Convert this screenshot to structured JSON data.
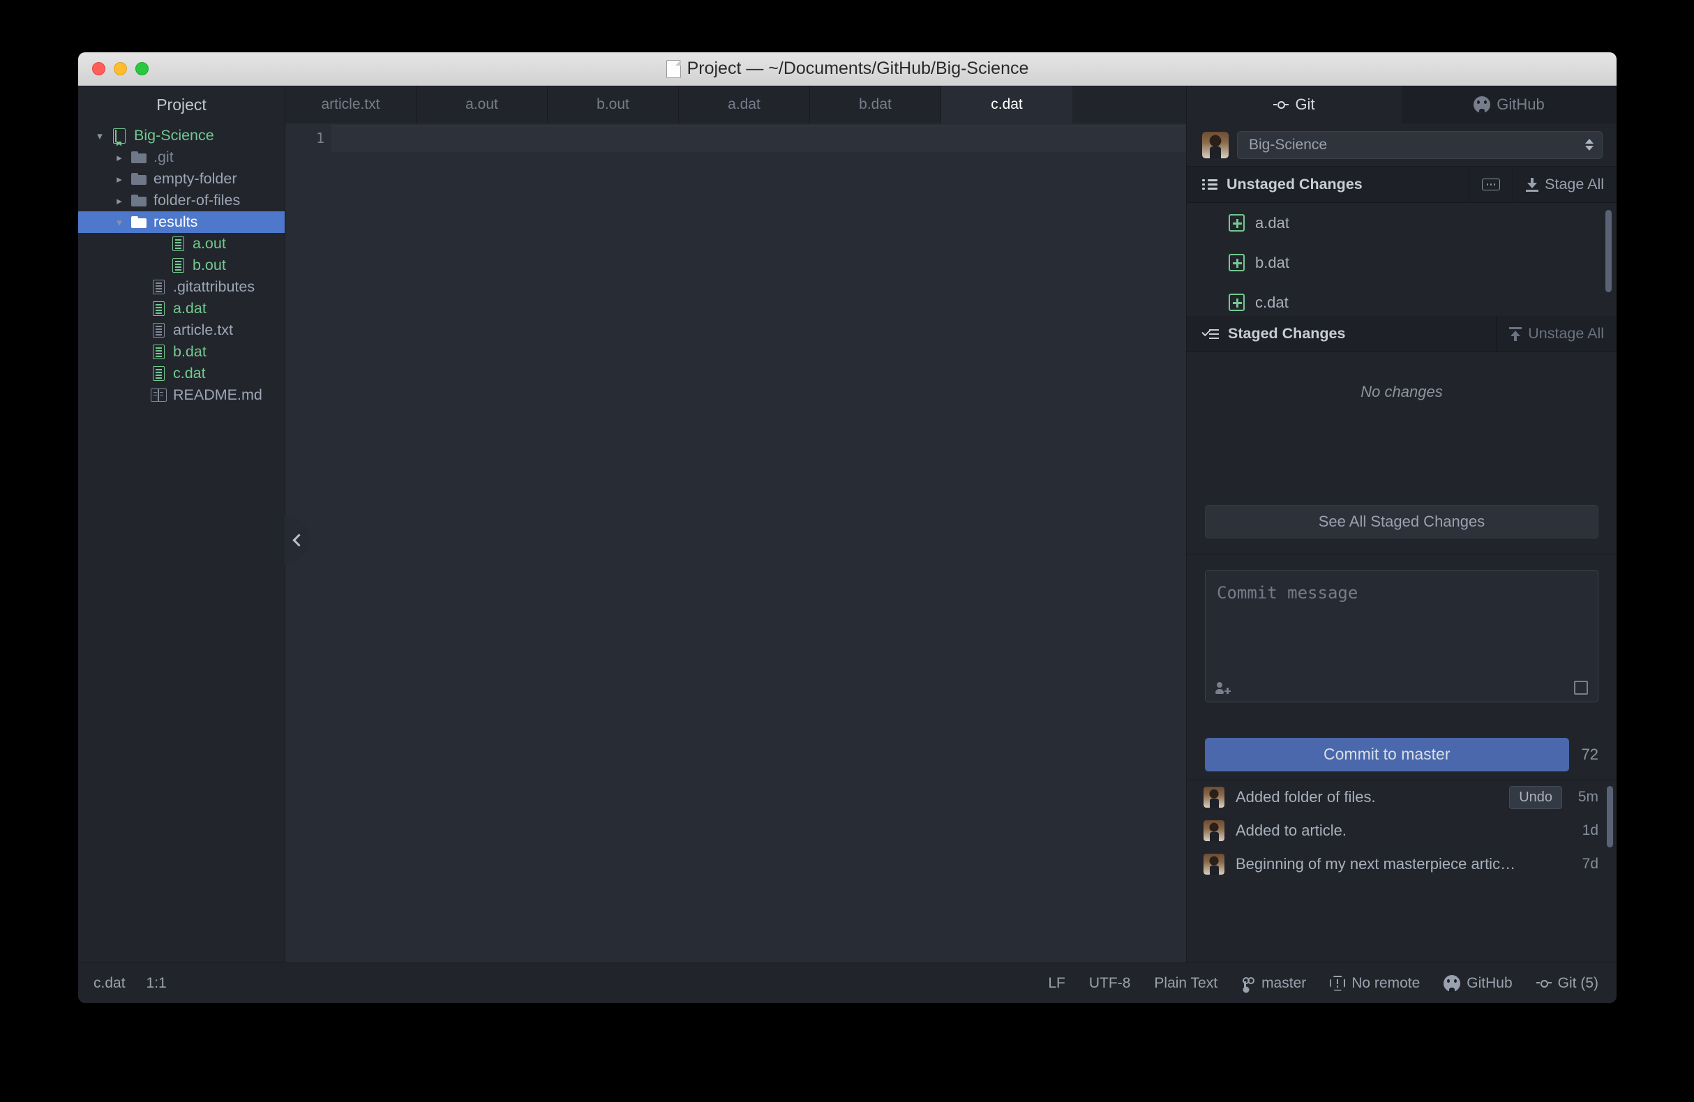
{
  "window": {
    "title": "Project — ~/Documents/GitHub/Big-Science",
    "title_icon": "document-icon",
    "traffic_lights": [
      "close-button",
      "minimize-button",
      "zoom-button"
    ]
  },
  "tree": {
    "header": "Project",
    "items": [
      {
        "label": "Big-Science",
        "icon": "book-icon",
        "twisty": "chevron-down",
        "indent": 0,
        "color": "green",
        "state": "expanded"
      },
      {
        "label": ".git",
        "icon": "folder-icon",
        "twisty": "chevron-right",
        "indent": 1,
        "color": "dim",
        "state": "collapsed"
      },
      {
        "label": "empty-folder",
        "icon": "folder-icon",
        "twisty": "chevron-right",
        "indent": 1,
        "color": "normal",
        "state": "collapsed"
      },
      {
        "label": "folder-of-files",
        "icon": "folder-icon",
        "twisty": "chevron-right",
        "indent": 1,
        "color": "normal",
        "state": "collapsed"
      },
      {
        "label": "results",
        "icon": "folder-icon",
        "twisty": "chevron-down",
        "indent": 1,
        "color": "normal",
        "state": "expanded",
        "selected": true
      },
      {
        "label": "a.out",
        "icon": "file-icon",
        "twisty": "none",
        "indent": 3,
        "color": "green"
      },
      {
        "label": "b.out",
        "icon": "file-icon",
        "twisty": "none",
        "indent": 3,
        "color": "green"
      },
      {
        "label": ".gitattributes",
        "icon": "file-icon",
        "twisty": "none",
        "indent": 2,
        "color": "normal"
      },
      {
        "label": "a.dat",
        "icon": "file-icon",
        "twisty": "none",
        "indent": 2,
        "color": "green"
      },
      {
        "label": "article.txt",
        "icon": "file-icon",
        "twisty": "none",
        "indent": 2,
        "color": "normal"
      },
      {
        "label": "b.dat",
        "icon": "file-icon",
        "twisty": "none",
        "indent": 2,
        "color": "green"
      },
      {
        "label": "c.dat",
        "icon": "file-icon",
        "twisty": "none",
        "indent": 2,
        "color": "green"
      },
      {
        "label": "README.md",
        "icon": "readme-icon",
        "twisty": "none",
        "indent": 2,
        "color": "normal"
      }
    ]
  },
  "editor": {
    "tabs": [
      {
        "label": "article.txt",
        "active": false
      },
      {
        "label": "a.out",
        "active": false
      },
      {
        "label": "b.out",
        "active": false
      },
      {
        "label": "a.dat",
        "active": false
      },
      {
        "label": "b.dat",
        "active": false
      },
      {
        "label": "c.dat",
        "active": true
      }
    ],
    "line_number": "1",
    "content": "",
    "collapse_handle_icon": "chevron-left-icon"
  },
  "git_panel": {
    "tabs": [
      {
        "label": "Git",
        "icon": "git-commit-icon",
        "active": true
      },
      {
        "label": "GitHub",
        "icon": "octocat-icon",
        "active": false
      }
    ],
    "repo": {
      "name": "Big-Science",
      "avatar": "user-avatar"
    },
    "unstaged": {
      "title": "Unstaged Changes",
      "title_icon": "list-icon",
      "menu_icon": "ellipsis-icon",
      "action_label": "Stage All",
      "action_icon": "download-icon",
      "items": [
        {
          "label": "a.dat",
          "status": "added"
        },
        {
          "label": "b.dat",
          "status": "added"
        },
        {
          "label": "c.dat",
          "status": "added"
        },
        {
          "label": "",
          "status": "added",
          "hover": true
        }
      ]
    },
    "staged": {
      "title": "Staged Changes",
      "title_icon": "checklist-icon",
      "action_label": "Unstage All",
      "action_icon": "upload-icon",
      "empty_text": "No changes",
      "see_all_label": "See All Staged Changes"
    },
    "commit": {
      "placeholder": "Commit message",
      "value": "",
      "coauthor_icon": "add-user-icon",
      "expand_icon": "expand-icon",
      "button_label": "Commit to master",
      "char_count": "72",
      "button_color": "#4a68ab"
    },
    "history": [
      {
        "message": "Added folder of files.",
        "undo_label": "Undo",
        "time": "5m"
      },
      {
        "message": "Added to article.",
        "time": "1d"
      },
      {
        "message": "Beginning of my next masterpiece artic…",
        "time": "7d"
      }
    ]
  },
  "statusbar": {
    "file": "c.dat",
    "cursor": "1:1",
    "right_items": [
      {
        "label": "LF",
        "icon": null
      },
      {
        "label": "UTF-8",
        "icon": null
      },
      {
        "label": "Plain Text",
        "icon": null
      },
      {
        "label": "master",
        "icon": "branch-icon"
      },
      {
        "label": "No remote",
        "icon": "alert-icon"
      },
      {
        "label": "GitHub",
        "icon": "octocat-icon"
      },
      {
        "label": "Git (5)",
        "icon": "git-commit-icon"
      }
    ]
  }
}
